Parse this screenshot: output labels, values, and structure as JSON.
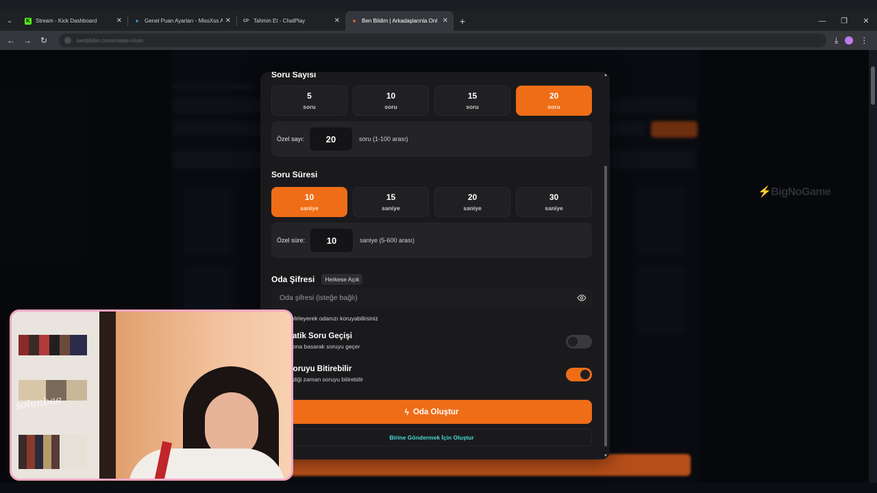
{
  "browser": {
    "tabs": [
      {
        "label": "Stream - Kick Dashboard",
        "fav": "K",
        "fav_color": "#53fc18",
        "active": false
      },
      {
        "label": "Genel Puan Ayarları - MissXss A",
        "fav": "●",
        "fav_color": "#3aa0e8",
        "active": false
      },
      {
        "label": "Tahmin Et - ChatPlay",
        "fav": "CP",
        "fav_color": "#6b6b6b",
        "active": false
      },
      {
        "label": "Ben Bildim | Arkadaşlarınla Onl",
        "fav": "●",
        "fav_color": "#e8713a",
        "active": true
      }
    ],
    "new_tab": "+",
    "url": "benbildim.com/create-room"
  },
  "watermark": "BigNoGame",
  "modal": {
    "question_count": {
      "title": "Soru Sayısı",
      "options": [
        {
          "value": "5",
          "unit": "soru",
          "selected": false
        },
        {
          "value": "10",
          "unit": "soru",
          "selected": false
        },
        {
          "value": "15",
          "unit": "soru",
          "selected": false
        },
        {
          "value": "20",
          "unit": "soru",
          "selected": true
        }
      ],
      "custom_label": "Özel sayı:",
      "custom_value": "20",
      "custom_hint": "soru (1-100 arası)"
    },
    "question_time": {
      "title": "Soru Süresi",
      "options": [
        {
          "value": "10",
          "unit": "saniye",
          "selected": true
        },
        {
          "value": "15",
          "unit": "saniye",
          "selected": false
        },
        {
          "value": "20",
          "unit": "saniye",
          "selected": false
        },
        {
          "value": "30",
          "unit": "saniye",
          "selected": false
        }
      ],
      "custom_label": "Özel süre:",
      "custom_value": "10",
      "custom_hint": "saniye (5-600 arası)"
    },
    "password": {
      "title": "Oda Şifresi",
      "badge": "Herkese Açık",
      "placeholder": "Oda şifresi (isteğe bağlı)",
      "help": "belirleyerek odanızı koruyabilirsiniz"
    },
    "auto_next": {
      "title": "natik Soru Geçişi",
      "desc": "utona basarak soruyu geçer",
      "enabled": false
    },
    "finish": {
      "title": "Soruyu Bitirebilir",
      "desc": "tediği zaman soruyu bitirebilir",
      "enabled": true
    },
    "create_button": "Oda Oluştur",
    "send_link": "Birine Göndermek İçin Oluştur"
  },
  "webcam": {
    "signature": "solunbae"
  },
  "colors": {
    "accent": "#ef6d17",
    "link": "#4ad8d3",
    "cam_border": "#f4a7c3"
  }
}
